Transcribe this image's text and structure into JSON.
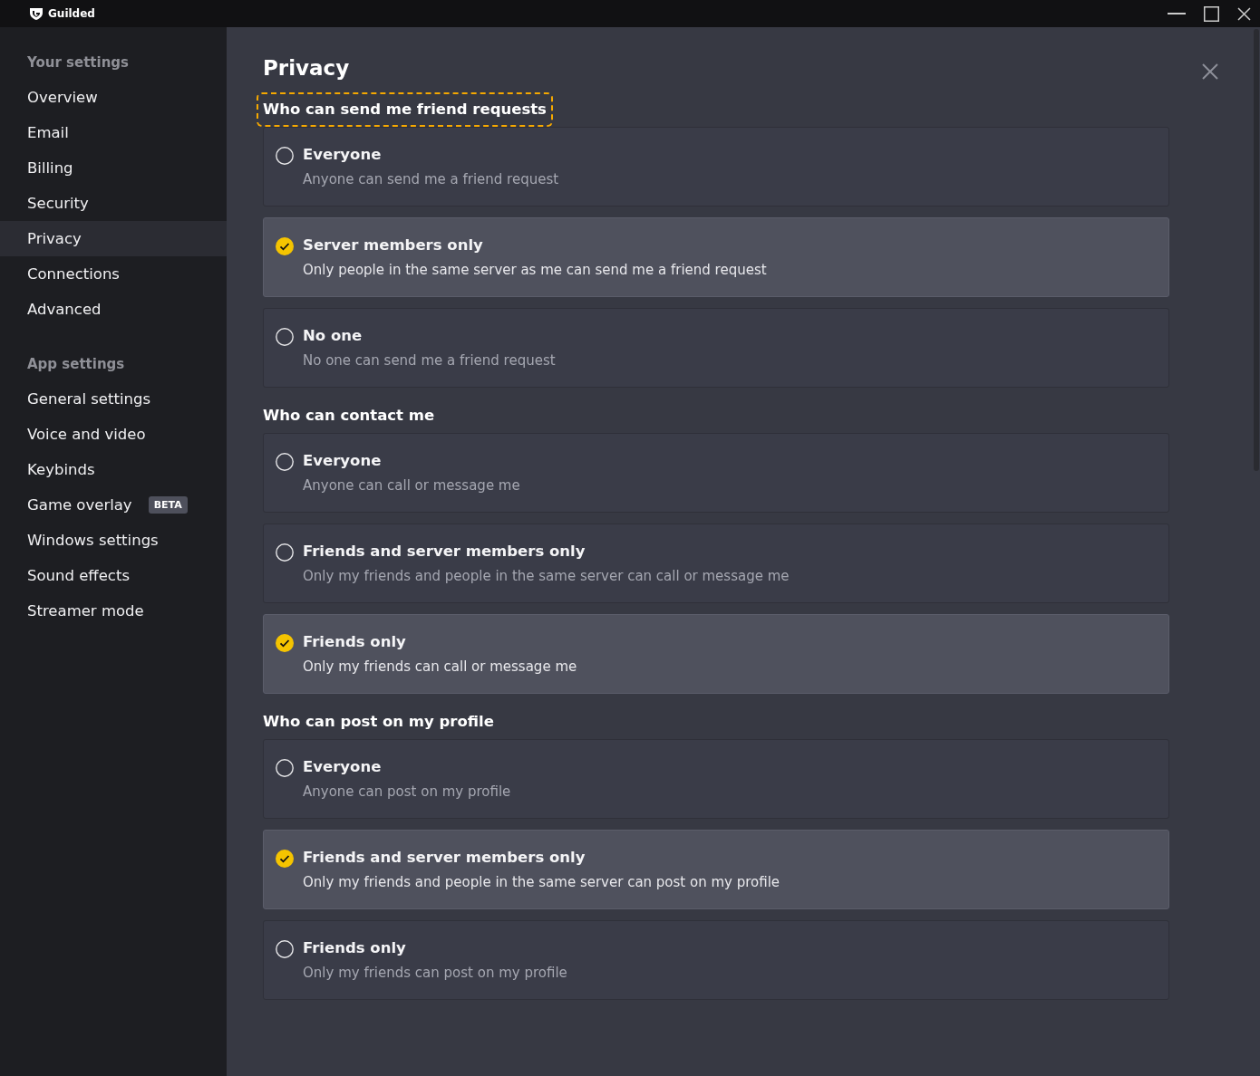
{
  "window": {
    "title": "Guilded"
  },
  "sidebar": [
    {
      "heading": "Your settings",
      "items": [
        {
          "label": "Overview",
          "selected": false
        },
        {
          "label": "Email",
          "selected": false
        },
        {
          "label": "Billing",
          "selected": false
        },
        {
          "label": "Security",
          "selected": false
        },
        {
          "label": "Privacy",
          "selected": true
        },
        {
          "label": "Connections",
          "selected": false
        },
        {
          "label": "Advanced",
          "selected": false
        }
      ]
    },
    {
      "heading": "App settings",
      "items": [
        {
          "label": "General settings",
          "selected": false
        },
        {
          "label": "Voice and video",
          "selected": false
        },
        {
          "label": "Keybinds",
          "selected": false
        },
        {
          "label": "Game overlay",
          "selected": false,
          "badge": "BETA"
        },
        {
          "label": "Windows settings",
          "selected": false
        },
        {
          "label": "Sound effects",
          "selected": false
        },
        {
          "label": "Streamer mode",
          "selected": false
        }
      ]
    }
  ],
  "page": {
    "title": "Privacy"
  },
  "sections": [
    {
      "heading": "Who can send me friend requests",
      "focused": true,
      "options": [
        {
          "title": "Everyone",
          "description": "Anyone can send me a friend request",
          "selected": false
        },
        {
          "title": "Server members only",
          "description": "Only people in the same server as me can send me a friend request",
          "selected": true
        },
        {
          "title": "No one",
          "description": "No one can send me a friend request",
          "selected": false
        }
      ]
    },
    {
      "heading": "Who can contact me",
      "focused": false,
      "options": [
        {
          "title": "Everyone",
          "description": "Anyone can call or message me",
          "selected": false
        },
        {
          "title": "Friends and server members only",
          "description": "Only my friends and people in the same server can call or message me",
          "selected": false
        },
        {
          "title": "Friends only",
          "description": "Only my friends can call or message me",
          "selected": true
        }
      ]
    },
    {
      "heading": "Who can post on my profile",
      "focused": false,
      "options": [
        {
          "title": "Everyone",
          "description": "Anyone can post on my profile",
          "selected": false
        },
        {
          "title": "Friends and server members only",
          "description": "Only my friends and people in the same server can post on my profile",
          "selected": true
        },
        {
          "title": "Friends only",
          "description": "Only my friends can post on my profile",
          "selected": false
        }
      ]
    }
  ]
}
